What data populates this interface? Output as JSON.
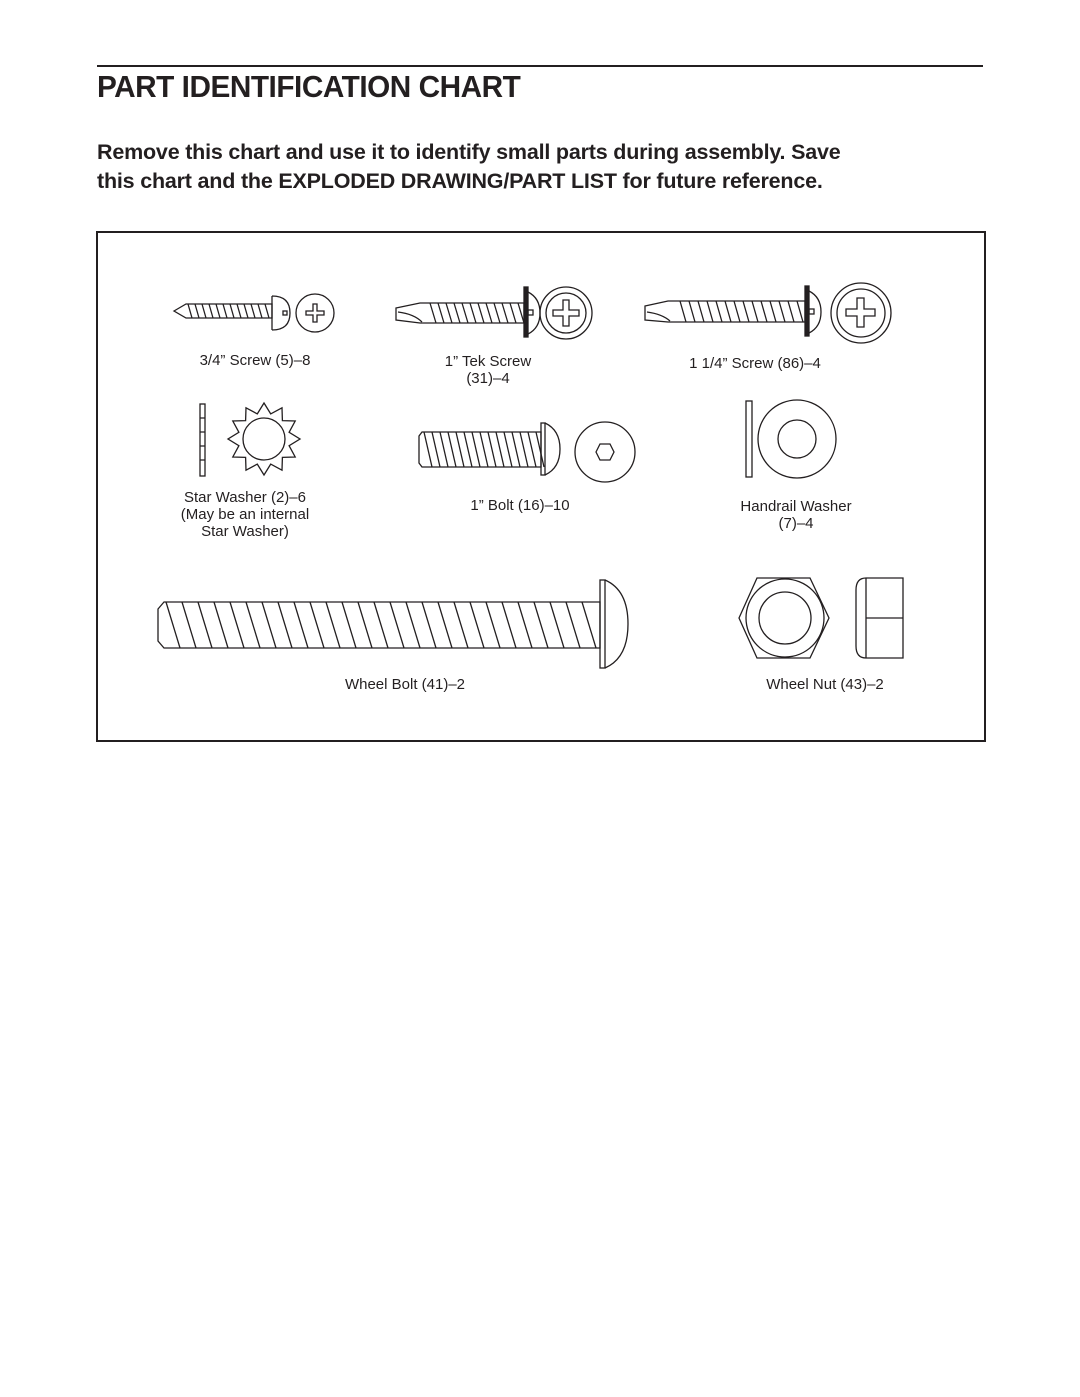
{
  "page": {
    "title": "PART IDENTIFICATION CHART",
    "intro_lines": [
      "Remove this chart and use it to identify small parts during assembly. Save",
      "this chart and the EXPLODED DRAWING/PART LIST for future reference."
    ]
  },
  "parts": [
    {
      "id": "screw-3-4",
      "label_lines": [
        "3/4” Screw (5)–8"
      ],
      "icon": "phillips-pan-head-screw-icon"
    },
    {
      "id": "tek-screw-1",
      "label_lines": [
        "1” Tek Screw",
        "(31)–4"
      ],
      "icon": "tek-screw-icon"
    },
    {
      "id": "screw-1-1-4",
      "label_lines": [
        "1 1/4” Screw (86)–4"
      ],
      "icon": "washer-head-screw-icon"
    },
    {
      "id": "star-washer",
      "label_lines": [
        "Star Washer (2)–6",
        "(May be an internal",
        "Star Washer)"
      ],
      "icon": "star-washer-icon"
    },
    {
      "id": "bolt-1",
      "label_lines": [
        "1” Bolt (16)–10"
      ],
      "icon": "hex-socket-button-bolt-icon"
    },
    {
      "id": "handrail-washer",
      "label_lines": [
        "Handrail Washer",
        "(7)–4"
      ],
      "icon": "flat-washer-icon"
    },
    {
      "id": "wheel-bolt",
      "label_lines": [
        "Wheel Bolt (41)–2"
      ],
      "icon": "long-button-bolt-icon"
    },
    {
      "id": "wheel-nut",
      "label_lines": [
        "Wheel Nut (43)–2"
      ],
      "icon": "hex-nut-icon"
    }
  ]
}
